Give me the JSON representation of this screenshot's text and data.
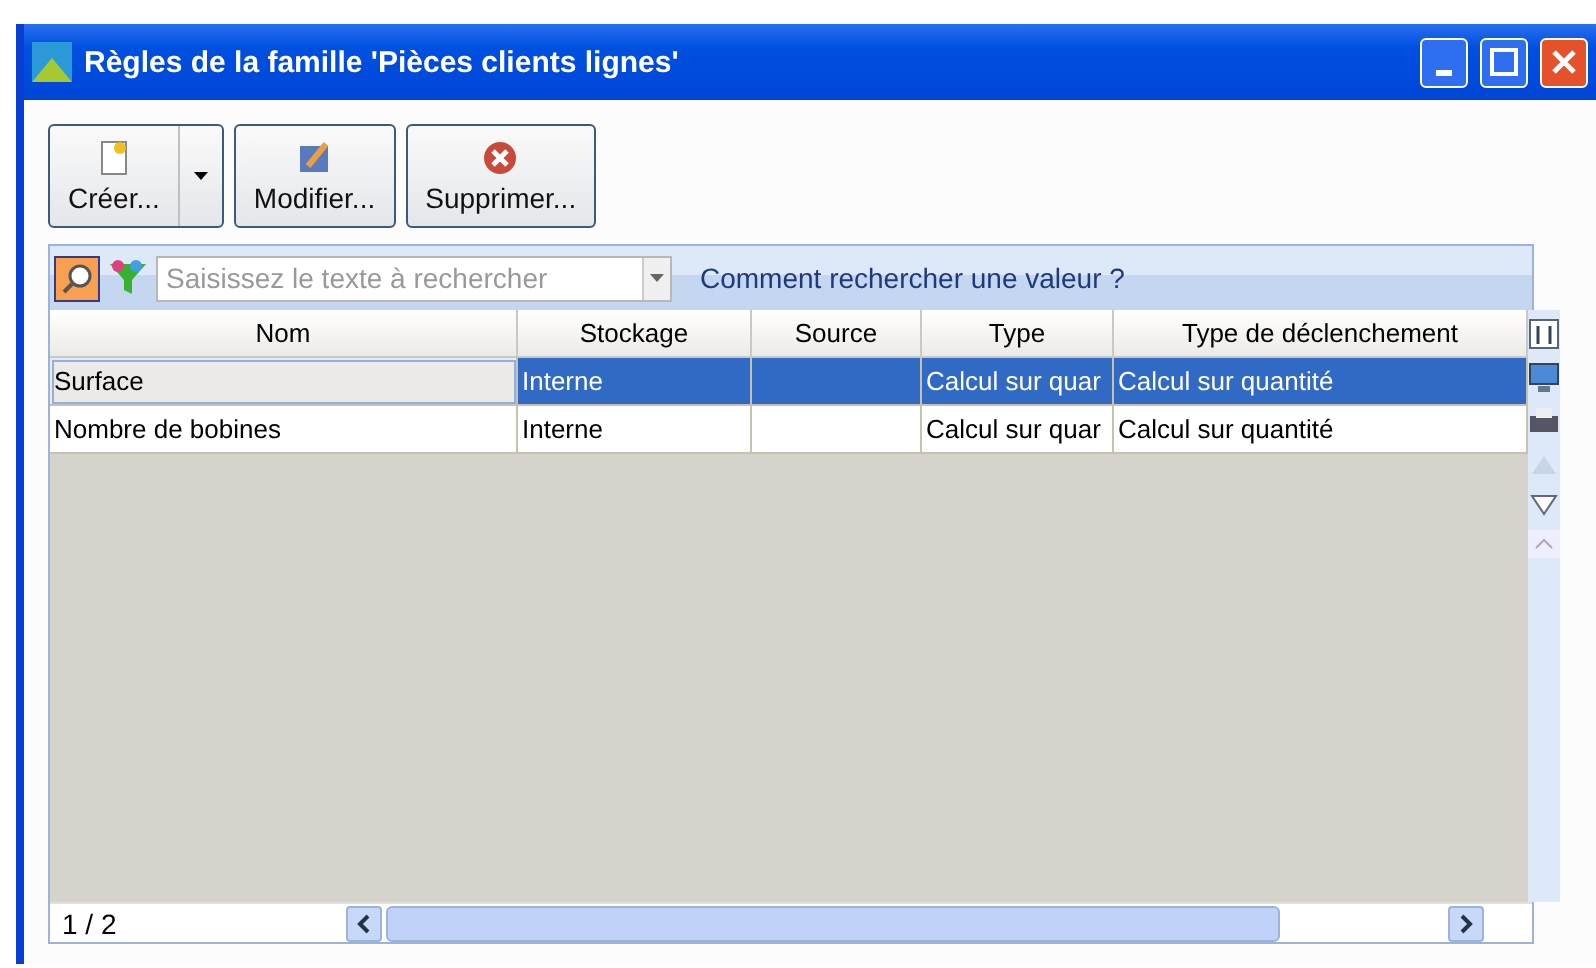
{
  "window": {
    "title": "Règles de la famille 'Pièces clients lignes'"
  },
  "toolbar": [
    {
      "label": "Créer...",
      "kind": "split"
    },
    {
      "label": "Modifier...",
      "kind": "plain"
    },
    {
      "label": "Supprimer...",
      "kind": "plain"
    }
  ],
  "search": {
    "placeholder": "Saisissez le texte à rechercher",
    "help_link": "Comment rechercher une valeur ?"
  },
  "table": {
    "columns": [
      "Nom",
      "Stockage",
      "Source",
      "Type",
      "Type de déclenchement"
    ],
    "rows": [
      {
        "cells": [
          "Surface",
          "Interne",
          "",
          "Calcul sur quar",
          "Calcul sur quantité"
        ],
        "selected": true
      },
      {
        "cells": [
          "Nombre de bobines",
          "Interne",
          "",
          "Calcul sur quar",
          "Calcul sur quantité"
        ],
        "selected": false
      }
    ]
  },
  "status_bar": {
    "counter": "1 / 2"
  }
}
